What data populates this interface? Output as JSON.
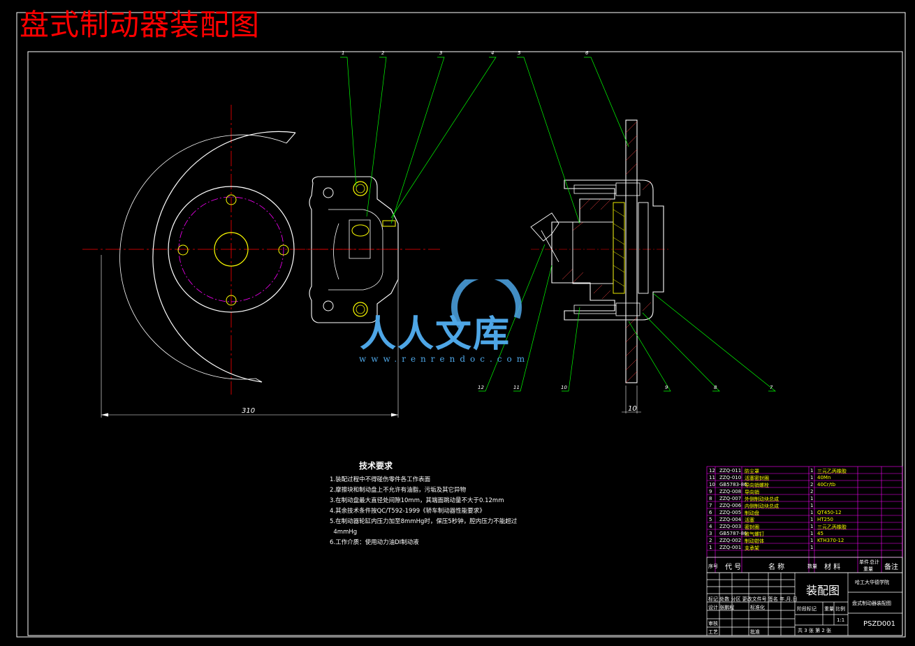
{
  "drawing": {
    "title": "盘式制动器装配图",
    "dimension_diameter": "310",
    "dimension_disc_thickness": "10",
    "callouts_top": [
      "1",
      "2",
      "3",
      "4",
      "5",
      "6"
    ],
    "callouts_bottom": [
      "12",
      "11",
      "10",
      "9",
      "8",
      "7"
    ]
  },
  "technical_requirements": {
    "heading": "技术要求",
    "items": [
      "1.装配过程中不得碰伤零件各工作表面",
      "2.摩擦块和制动盘上不允许有油脂，污垢及其它异物",
      "3.在制动盘最大直径处间隙10mm，其端面跳动量不大于0.12mm",
      "4.其余技术条件按QC/T592-1999《轿车制动器性能要求》",
      "5.在制动器轮缸内压力加至8mmHg时，保压5秒钟，腔内压力不能超过",
      "  4mmHg",
      "6.工作介质：使用动力油DI制动液"
    ]
  },
  "watermark": {
    "brand": "人人文库",
    "url": "www.renrendoc.com"
  },
  "parts_list": [
    {
      "no": "12",
      "code": "ZZQ-011",
      "name": "防尘罩",
      "qty": "1",
      "material": "三元乙丙橡胶"
    },
    {
      "no": "11",
      "code": "ZZQ-010",
      "name": "活塞密封圈",
      "qty": "1",
      "material": "40Mn"
    },
    {
      "no": "10",
      "code": "GB5783-86",
      "name": "导向销螺栓",
      "qty": "2",
      "material": "40Cr/tb"
    },
    {
      "no": "9",
      "code": "ZZQ-008",
      "name": "导向销",
      "qty": "2",
      "material": ""
    },
    {
      "no": "8",
      "code": "ZZQ-007",
      "name": "外侧制动块总成",
      "qty": "1",
      "material": ""
    },
    {
      "no": "7",
      "code": "ZZQ-006",
      "name": "内侧制动块总成",
      "qty": "1",
      "material": ""
    },
    {
      "no": "6",
      "code": "ZZQ-005",
      "name": "制动盘",
      "qty": "1",
      "material": "QT450-12"
    },
    {
      "no": "5",
      "code": "ZZQ-004",
      "name": "活塞",
      "qty": "1",
      "material": "HT250"
    },
    {
      "no": "4",
      "code": "ZZQ-003",
      "name": "密封圈",
      "qty": "1",
      "material": "三元乙丙橡胶"
    },
    {
      "no": "3",
      "code": "GB5787-86",
      "name": "放气螺钉",
      "qty": "1",
      "material": "45"
    },
    {
      "no": "2",
      "code": "ZZQ-002",
      "name": "制动钳体",
      "qty": "1",
      "material": "KTH370-12"
    },
    {
      "no": "1",
      "code": "ZZQ-001",
      "name": "支承架",
      "qty": "1",
      "material": ""
    }
  ],
  "parts_header": {
    "no": "序号",
    "code": "代 号",
    "name": "名 称",
    "qty": "数量",
    "material": "材 料",
    "unit_weight": "单件",
    "total_weight": "总计",
    "weight": "重量",
    "remark": "备注"
  },
  "title_block": {
    "drawing_type": "装配图",
    "school": "哈工大华德学院",
    "drawing_name": "盘式制动器装配图",
    "drawing_no": "PSZD001",
    "scale": "1:1",
    "sheet_info": "共 3 张  第 2 张",
    "stage_label": "阶段标记",
    "weight_label": "重量",
    "scale_label": "比例",
    "mark_row": "标记 处数 分区 更改文件号 签名 年.月.日",
    "design_row": "设计 张鹏程",
    "standard_label": "标准化",
    "review_label": "审核",
    "process_label": "工艺",
    "approve_label": "批准"
  }
}
